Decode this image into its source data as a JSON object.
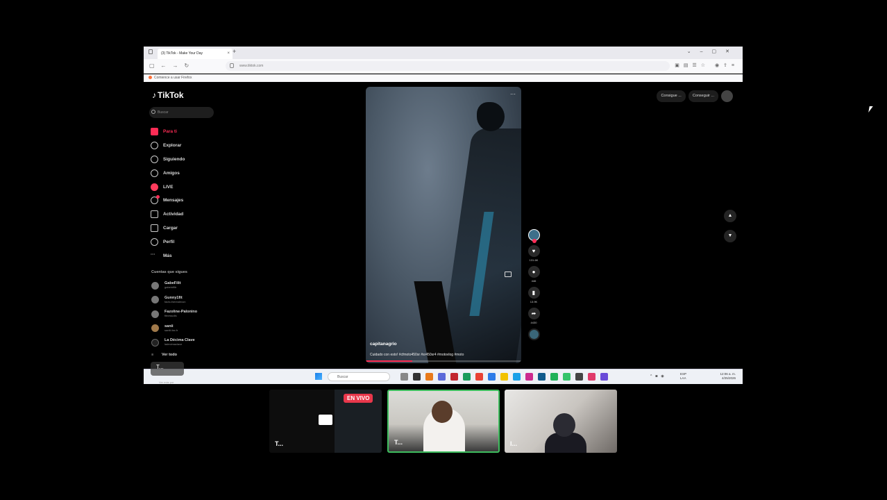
{
  "browser": {
    "tab_title": "(3) TikTok - Make Your Day",
    "url": "www.tiktok.com",
    "bookmark": "Comience a usar Firefox"
  },
  "tiktok": {
    "logo": "TikTok",
    "search_placeholder": "Buscar",
    "menu": [
      {
        "label": "Para ti",
        "icon": "home-icon",
        "active": true
      },
      {
        "label": "Explorar",
        "icon": "compass-icon"
      },
      {
        "label": "Siguiendo",
        "icon": "following-icon"
      },
      {
        "label": "Amigos",
        "icon": "friends-icon"
      },
      {
        "label": "LIVE",
        "icon": "live-icon"
      },
      {
        "label": "Mensajes",
        "icon": "messages-icon"
      },
      {
        "label": "Actividad",
        "icon": "activity-icon"
      },
      {
        "label": "Cargar",
        "icon": "upload-icon"
      },
      {
        "label": "Perfil",
        "icon": "profile-icon"
      },
      {
        "label": "Más",
        "icon": "more-icon"
      }
    ],
    "following_title": "Cuentas que sigues",
    "accounts": [
      {
        "name": "GabeFilit",
        "handle": "gabeinfiltr"
      },
      {
        "name": "Gunny1fit",
        "handle": "facts.therealexon"
      },
      {
        "name": "Fazoline-Palonino",
        "handle": "fitnessolis"
      },
      {
        "name": "sanii",
        "handle": "saniti.fax.fr"
      },
      {
        "name": "La Décima Clave",
        "handle": "ladecimaclave"
      }
    ],
    "see_all": "Ver todo",
    "top_buttons": [
      "Consigue ...",
      "Conseguir ..."
    ],
    "video": {
      "author": "capitanagrio",
      "caption": "Cuidado con esto! #cfmoto450sr #sr450sr4 #motovlog #moto"
    },
    "actions": [
      {
        "icon": "heart-icon",
        "count": "131.6K"
      },
      {
        "icon": "comment-icon",
        "count": "446"
      },
      {
        "icon": "bookmark-icon",
        "count": "13.9K"
      },
      {
        "icon": "share-icon",
        "count": "4430"
      }
    ]
  },
  "taskbar": {
    "search_placeholder": "Buscar",
    "lang": "ESP\nLAA",
    "time": "12:06 a. m.",
    "date": "4/25/2026"
  },
  "overlay": {
    "share_label": "T...",
    "share_sub": "Ver más por"
  },
  "participants": [
    {
      "label": "T...",
      "live_badge": "EN VIVO"
    },
    {
      "label": "T..."
    },
    {
      "label": "I..."
    }
  ]
}
